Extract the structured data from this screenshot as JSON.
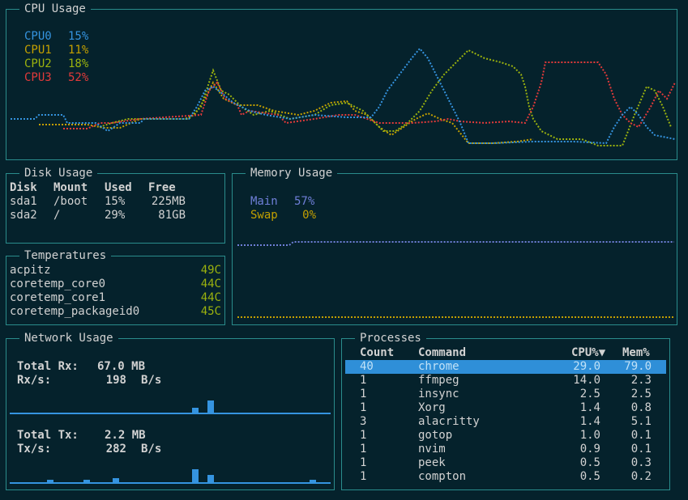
{
  "colors": {
    "bg": "#05222c",
    "border": "#2a8c8c",
    "text": "#d2d2d2",
    "cpu0": "#3594e0",
    "cpu1": "#c4a000",
    "cpu2": "#9bb20e",
    "cpu3": "#e23a3a",
    "main": "#6f7fd8",
    "swap": "#c4a000",
    "selected": "#2f8fd8"
  },
  "cpu": {
    "title": "CPU Usage",
    "legend": [
      {
        "name": "CPU0",
        "value": "15%"
      },
      {
        "name": "CPU1",
        "value": "11%"
      },
      {
        "name": "CPU2",
        "value": "18%"
      },
      {
        "name": "CPU3",
        "value": "52%"
      }
    ]
  },
  "disk": {
    "title": "Disk Usage",
    "headers": [
      "Disk",
      "Mount",
      "Used",
      "Free"
    ],
    "rows": [
      [
        "sda1",
        "/boot",
        "15%",
        "225MB"
      ],
      [
        "sda2",
        "/",
        "29%",
        "81GB"
      ]
    ]
  },
  "temps": {
    "title": "Temperatures",
    "rows": [
      {
        "name": "acpitz",
        "value": "49C"
      },
      {
        "name": "coretemp_core0",
        "value": "44C"
      },
      {
        "name": "coretemp_core1",
        "value": "44C"
      },
      {
        "name": "coretemp_packageid0",
        "value": "45C"
      }
    ]
  },
  "memory": {
    "title": "Memory Usage",
    "legend": [
      {
        "name": "Main",
        "value": "57%"
      },
      {
        "name": "Swap",
        "value": "0%"
      }
    ]
  },
  "network": {
    "title": "Network Usage",
    "rx_total_label": "Total Rx:",
    "rx_total": "67.0 MB",
    "rx_rate_label": "Rx/s:",
    "rx_rate": "198",
    "rx_unit": "B/s",
    "tx_total_label": "Total Tx:",
    "tx_total": "2.2 MB",
    "tx_rate_label": "Tx/s:",
    "tx_rate": "282",
    "tx_unit": "B/s"
  },
  "processes": {
    "title": "Processes",
    "headers": [
      "Count",
      "Command",
      "CPU%▼",
      "Mem%"
    ],
    "rows": [
      [
        "40",
        "chrome",
        "29.0",
        "79.0"
      ],
      [
        "1",
        "ffmpeg",
        "14.0",
        "2.3"
      ],
      [
        "1",
        "insync",
        "2.5",
        "2.5"
      ],
      [
        "1",
        "Xorg",
        "1.4",
        "0.8"
      ],
      [
        "3",
        "alacritty",
        "1.4",
        "5.1"
      ],
      [
        "1",
        "gotop",
        "1.0",
        "0.1"
      ],
      [
        "1",
        "nvim",
        "0.9",
        "0.1"
      ],
      [
        "1",
        "peek",
        "0.5",
        "0.3"
      ],
      [
        "1",
        "compton",
        "0.5",
        "0.2"
      ]
    ]
  }
}
